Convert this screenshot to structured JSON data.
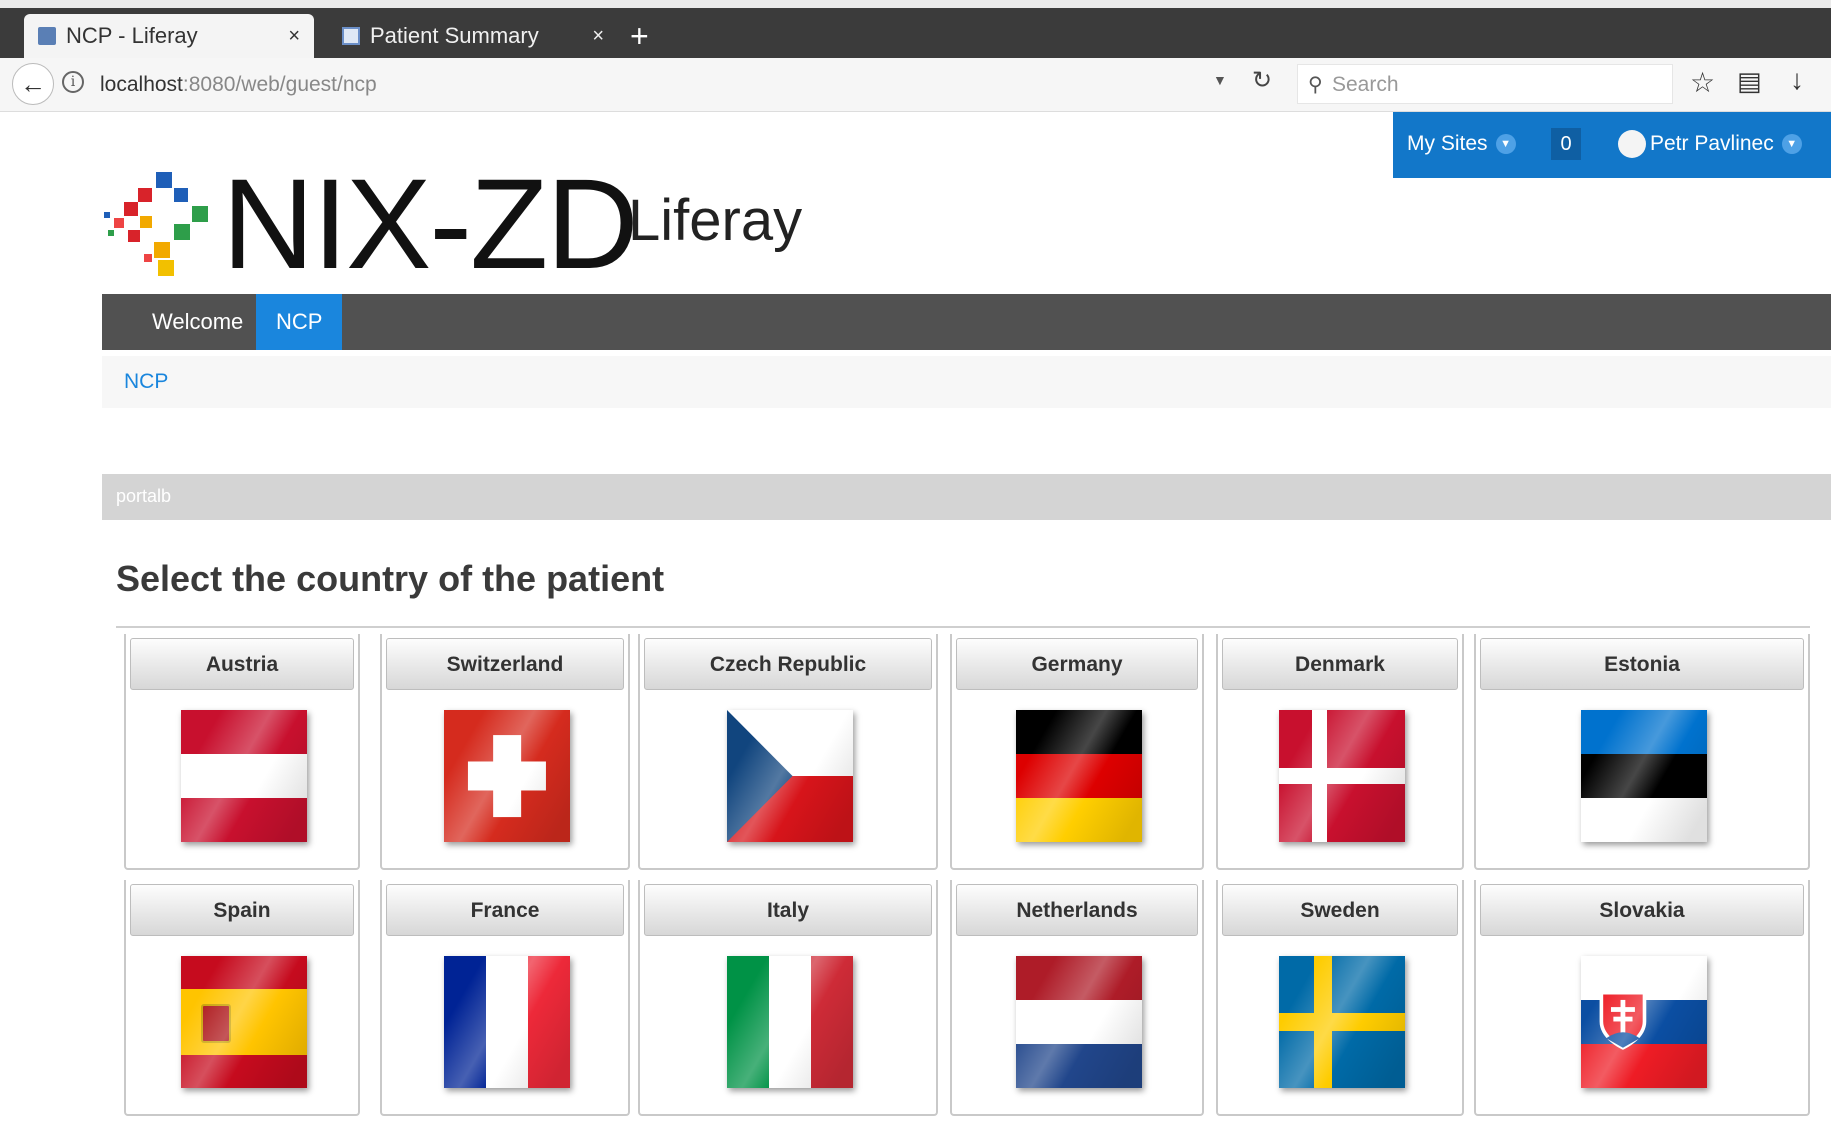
{
  "browser": {
    "tabs": [
      {
        "label": "NCP - Liferay",
        "active": true
      },
      {
        "label": "Patient Summary",
        "active": false
      }
    ],
    "url_host": "localhost",
    "url_path": ":8080/web/guest/ncp",
    "search_placeholder": "Search"
  },
  "dockbar": {
    "my_sites": "My Sites",
    "notifications": "0",
    "user": "Petr Pavlinec"
  },
  "logo": {
    "title": "NIX-ZD",
    "subtitle": "Liferay"
  },
  "nav": {
    "items": [
      "Welcome",
      "NCP"
    ],
    "active": "NCP"
  },
  "breadcrumb": "NCP",
  "portlet": {
    "bar_label": "portalb",
    "heading": "Select the country of the patient"
  },
  "countries": [
    {
      "name": "Austria",
      "flag": "austria-flag"
    },
    {
      "name": "Switzerland",
      "flag": "switzerland-flag"
    },
    {
      "name": "Czech Republic",
      "flag": "czech-flag"
    },
    {
      "name": "Germany",
      "flag": "germany-flag"
    },
    {
      "name": "Denmark",
      "flag": "denmark-flag"
    },
    {
      "name": "Estonia",
      "flag": "estonia-flag"
    },
    {
      "name": "Spain",
      "flag": "spain-flag"
    },
    {
      "name": "France",
      "flag": "france-flag"
    },
    {
      "name": "Italy",
      "flag": "italy-flag"
    },
    {
      "name": "Netherlands",
      "flag": "netherlands-flag"
    },
    {
      "name": "Sweden",
      "flag": "sweden-flag"
    },
    {
      "name": "Slovakia",
      "flag": "slovakia-flag"
    }
  ],
  "colors": {
    "accent": "#1a86dd",
    "dockbar": "#1277c9",
    "nav": "#515151"
  }
}
